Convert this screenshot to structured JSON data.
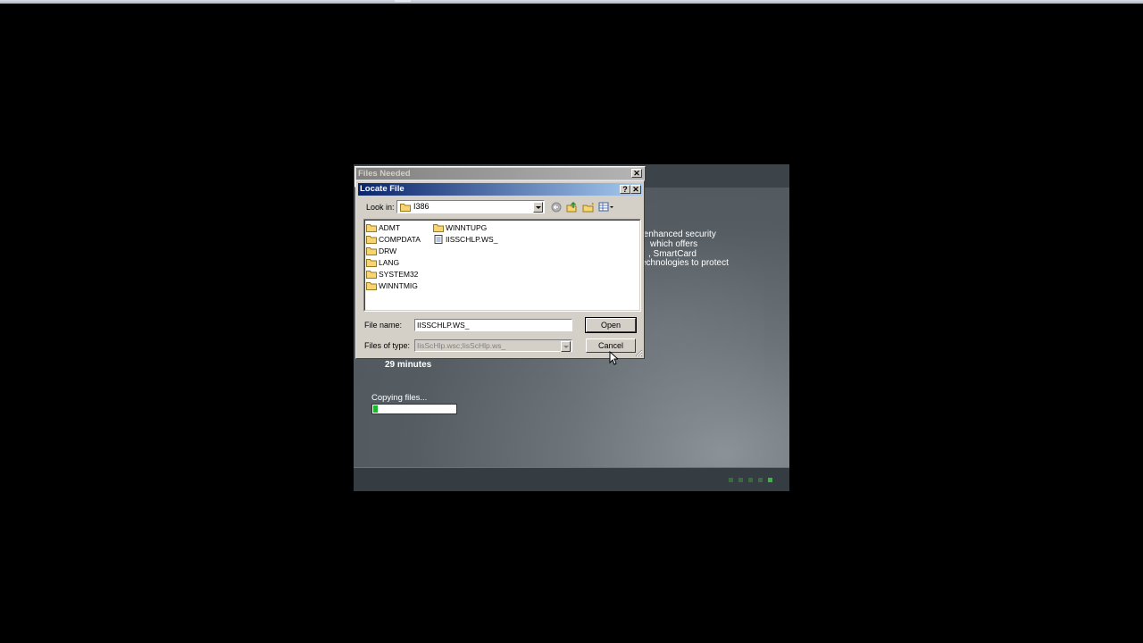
{
  "setup_screen": {
    "info_lines": [
      "ers enhanced security",
      "which offers",
      ", SmartCard",
      "echnologies to protect"
    ],
    "time_remaining": "29 minutes",
    "status": "Copying files...",
    "progress": 0.05,
    "steps_total": 5,
    "steps_active": 5
  },
  "files_needed_dialog": {
    "title": "Files Needed"
  },
  "locate_file_dialog": {
    "title": "Locate File",
    "look_in_label": "Look in:",
    "look_in_value": "I386",
    "items_col1": [
      "ADMT",
      "COMPDATA",
      "DRW",
      "LANG",
      "SYSTEM32",
      "WINNTMIG"
    ],
    "items_col2": [
      {
        "name": "WINNTUPG",
        "icon": "folder-icon"
      },
      {
        "name": "IISSCHLP.WS_",
        "icon": "file-icon"
      }
    ],
    "file_name_label": "File name:",
    "file_name_value": "IISSCHLP.WS_",
    "files_of_type_label": "Files of type:",
    "files_of_type_value": "IisScHlp.wsc;IisScHlp.ws_",
    "open_label": "Open",
    "cancel_label": "Cancel",
    "help_glyph": "?",
    "close_glyph": "✕"
  },
  "colors": {
    "titlebar_active": "#0a246a",
    "titlebar_inactive": "#808080",
    "progress": "#1db52a",
    "dialog_face": "#d4d0c8"
  }
}
